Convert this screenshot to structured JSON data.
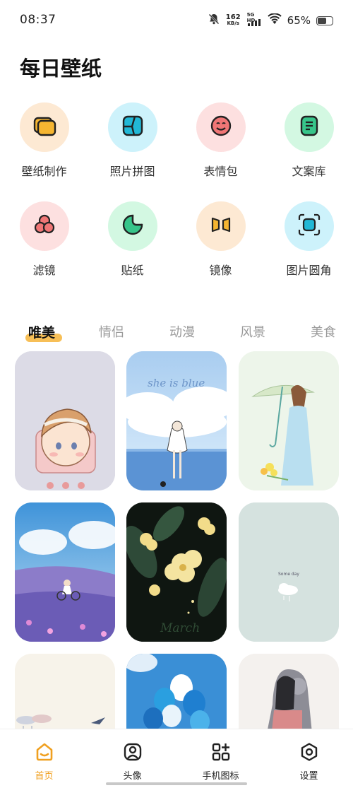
{
  "status_bar": {
    "time": "08:37",
    "net_speed_value": "162",
    "net_speed_unit": "KB/s",
    "signal_label": "5G HD",
    "battery_percent": "65%",
    "battery_level": 0.65,
    "icons": [
      "bell-off-icon",
      "signal-icon",
      "wifi-icon",
      "battery-icon"
    ]
  },
  "header": {
    "title": "每日壁纸"
  },
  "tools": [
    {
      "label": "壁纸制作",
      "icon": "wallpaper-make-icon",
      "bg": "#fde9d3",
      "accent": "#f5b531"
    },
    {
      "label": "照片拼图",
      "icon": "collage-icon",
      "bg": "#cdf2fb",
      "accent": "#22b8d6"
    },
    {
      "label": "表情包",
      "icon": "emoji-icon",
      "bg": "#fde0e0",
      "accent": "#f07676"
    },
    {
      "label": "文案库",
      "icon": "document-icon",
      "bg": "#d3f8e2",
      "accent": "#37c58a"
    },
    {
      "label": "滤镜",
      "icon": "filter-icon",
      "bg": "#fde0e0",
      "accent": "#f07676"
    },
    {
      "label": "贴纸",
      "icon": "sticker-icon",
      "bg": "#d3f8e2",
      "accent": "#37c58a"
    },
    {
      "label": "镜像",
      "icon": "mirror-icon",
      "bg": "#fde9d3",
      "accent": "#f5b531"
    },
    {
      "label": "图片圆角",
      "icon": "rounded-corner-icon",
      "bg": "#cdf2fb",
      "accent": "#22b8d6"
    }
  ],
  "categories": {
    "active_index": 0,
    "items": [
      "唯美",
      "情侣",
      "动漫",
      "风景",
      "美食"
    ]
  },
  "wallpapers": {
    "cards": [
      {
        "name": "anime-boy-wallpaper",
        "text": ""
      },
      {
        "name": "she-is-blue-wallpaper",
        "text": "she is blue"
      },
      {
        "name": "girl-umbrella-wallpaper",
        "text": ""
      },
      {
        "name": "lavender-field-wallpaper",
        "text": ""
      },
      {
        "name": "flowers-night-wallpaper",
        "text": "March"
      },
      {
        "name": "some-day-cloud-wallpaper",
        "text": "Some day"
      },
      {
        "name": "rain-cloud-wallpaper",
        "text": ""
      },
      {
        "name": "balloons-wallpaper",
        "text": ""
      },
      {
        "name": "couple-sketch-wallpaper",
        "text": ""
      }
    ]
  },
  "bottom_nav": {
    "active_index": 0,
    "accent": "#f0a020",
    "items": [
      {
        "label": "首页",
        "icon": "home-icon"
      },
      {
        "label": "头像",
        "icon": "avatar-icon"
      },
      {
        "label": "手机图标",
        "icon": "app-grid-icon"
      },
      {
        "label": "设置",
        "icon": "settings-icon"
      }
    ]
  }
}
